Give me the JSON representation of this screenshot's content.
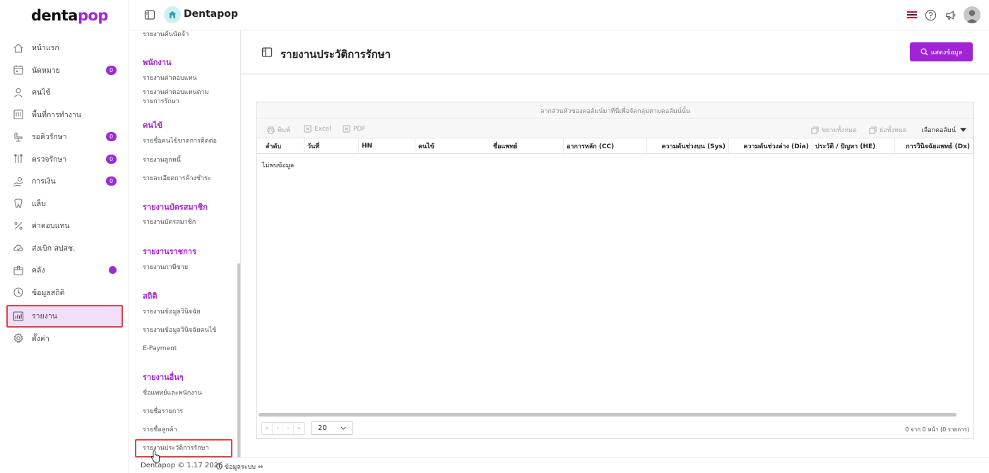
{
  "brand": {
    "logo_main": "denta",
    "logo_accent": "pop",
    "accent_color": "#a424d6"
  },
  "sidebar": {
    "items": [
      {
        "label": "หน้าแรก",
        "icon": "home-icon"
      },
      {
        "label": "นัดหมาย",
        "icon": "calendar-icon",
        "badge": "0"
      },
      {
        "label": "คนไข้",
        "icon": "user-icon"
      },
      {
        "label": "พื้นที่การทำงาน",
        "icon": "workspace-icon"
      },
      {
        "label": "รอคิวรักษา",
        "icon": "dental-chair-icon",
        "badge": "0"
      },
      {
        "label": "ตรวจรักษา",
        "icon": "tools-icon",
        "badge": "0"
      },
      {
        "label": "การเงิน",
        "icon": "money-hand-icon",
        "badge": "0"
      },
      {
        "label": "แล็บ",
        "icon": "tooth-icon"
      },
      {
        "label": "ค่าตอบแทน",
        "icon": "percent-icon"
      },
      {
        "label": "ส่งเบิก สปสช.",
        "icon": "cloud-icon"
      },
      {
        "label": "คลัง",
        "icon": "box-icon",
        "dot": true
      },
      {
        "label": "ข้อมูลสถิติ",
        "icon": "stats-icon"
      },
      {
        "label": "รายงาน",
        "icon": "report-chart-icon",
        "active": true
      },
      {
        "label": "ตั้งค่า",
        "icon": "gear-icon"
      }
    ]
  },
  "topbar": {
    "title": "Dentapop"
  },
  "report_menu": {
    "items": [
      {
        "type": "item",
        "label": "รายงานค้นนัดจ้า",
        "top": 0
      },
      {
        "type": "head",
        "label": "พนักงาน"
      },
      {
        "type": "item",
        "label": "รายงานค่าตอบแทน"
      },
      {
        "type": "item",
        "label": "รายงานค่าตอบแทนตามรายการรักษา"
      },
      {
        "type": "head",
        "label": "คนไข้"
      },
      {
        "type": "item",
        "label": "รายชื่อคนไข้ขาดการติดต่อ"
      },
      {
        "type": "item",
        "label": "รายงานลูกหนี้"
      },
      {
        "type": "item",
        "label": "รายละเอียดการค้างชำระ"
      },
      {
        "type": "head",
        "label": "รายงานบัตรสมาชิก"
      },
      {
        "type": "item",
        "label": "รายงานบัตรสมาชิก"
      },
      {
        "type": "head",
        "label": "รายงานราชการ"
      },
      {
        "type": "item",
        "label": "รายงานภาษีขาย"
      },
      {
        "type": "head",
        "label": "สถิติ"
      },
      {
        "type": "item",
        "label": "รายงานข้อมูลวินิจฉัย"
      },
      {
        "type": "item",
        "label": "รายงานข้อมูลวินิจฉัยคนไข้"
      },
      {
        "type": "item",
        "label": "E-Payment"
      },
      {
        "type": "head",
        "label": "รายงานอื่นๆ"
      },
      {
        "type": "item",
        "label": "ชื่อแพทย์และพนักงาน"
      },
      {
        "type": "item",
        "label": "รายชื่อรายการ"
      },
      {
        "type": "item",
        "label": "รายชื่อลูกค้า"
      },
      {
        "type": "item",
        "label": "รายงานประวัติการรักษา",
        "selected": true
      }
    ]
  },
  "page": {
    "title": "รายงานประวัติการรักษา",
    "show_button": "แสดงข้อมูล"
  },
  "grid": {
    "group_hint": "ลากส่วนหัวของคอลัมน์มาที่นี่เพื่อจัดกลุ่มตามคอลัมน์นั้น",
    "tools": {
      "print": "พิมพ์",
      "excel": "Excel",
      "pdf": "PDF",
      "expand_all": "ขยายทั้งหมด",
      "collapse_all": "ย่อทั้งหมด",
      "column_chooser": "เลือกคอลัมน์"
    },
    "columns": [
      "ลำดับ",
      "วันที่",
      "HN",
      "คนไข้",
      "ชื่อแพทย์",
      "อาการหลัก (CC)",
      "ความดันช่วงบน (Sys)",
      "ความดันช่วงล่าง (Dia)",
      "ประวัติ / ปัญหา (HE)",
      "การวินิจฉัยแพทย์ (Dx)"
    ],
    "no_data": "ไม่พบข้อมูล",
    "page_size": "20",
    "page_info": "0 จาก 0 หน้า (0 รายการ)",
    "pager_buttons": [
      "«",
      "‹",
      "›",
      "»"
    ]
  },
  "footer": {
    "copyright": "Dentapop © 1.17 2026",
    "system_info": "ข้อมูลระบบ"
  }
}
